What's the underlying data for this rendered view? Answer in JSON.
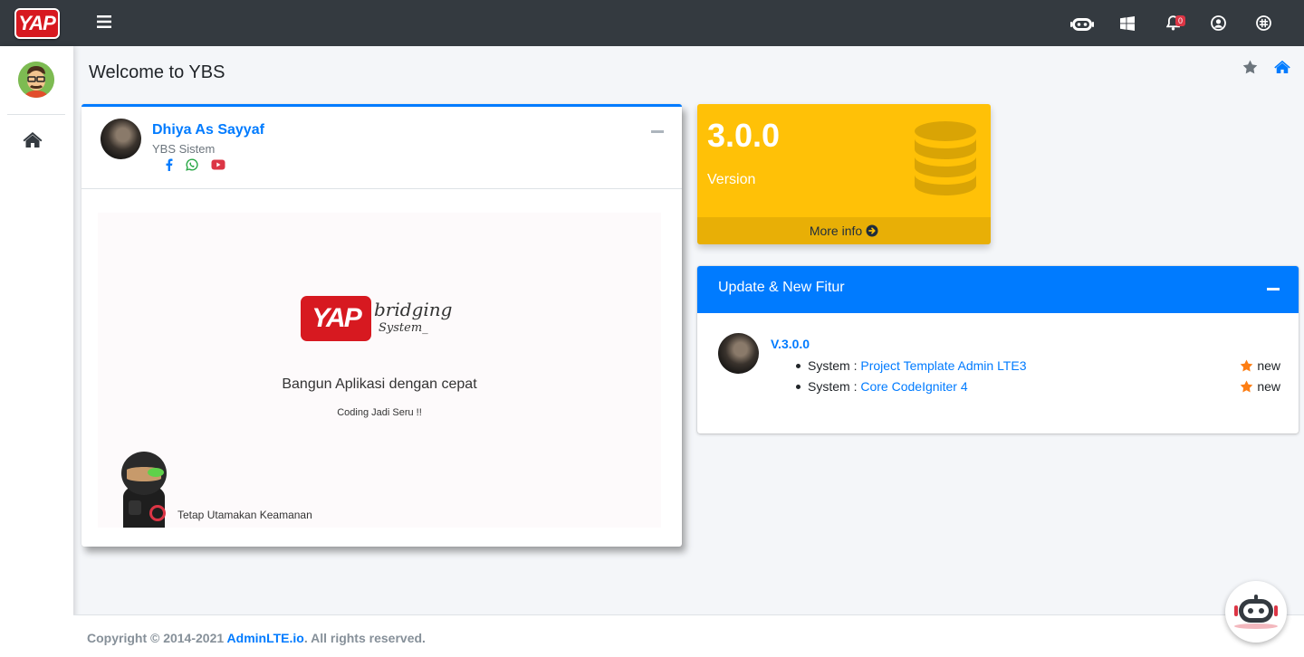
{
  "brand": {
    "logo_text": "YAP"
  },
  "page": {
    "title": "Welcome to YBS"
  },
  "navbar": {
    "notification_count": "0",
    "icons": [
      "robot-icon",
      "windows-icon",
      "bell-icon",
      "user-circle-icon",
      "slack-icon"
    ]
  },
  "profile": {
    "name": "Dhiya As Sayyaf",
    "subtitle": "YBS Sistem"
  },
  "banner": {
    "logo_text": "YAP",
    "bridging": "bridging",
    "system": "System_",
    "tagline": "Bangun Aplikasi dengan cepat",
    "subtagline": "Coding Jadi Seru !!",
    "security_text": "Tetap Utamakan Keamanan"
  },
  "version_box": {
    "number": "3.0.0",
    "label": "Version",
    "more_info": "More info"
  },
  "updates": {
    "title": "Update & New Fitur",
    "version": "V.3.0.0",
    "items": [
      {
        "prefix": "System : ",
        "link": "Project Template Admin LTE3",
        "badge": "new"
      },
      {
        "prefix": "System : ",
        "link": "Core CodeIgniter 4",
        "badge": "new"
      }
    ]
  },
  "footer": {
    "prefix": "Copyright © 2014-2021 ",
    "link": "AdminLTE.io",
    "suffix": ". All rights reserved."
  },
  "colors": {
    "primary": "#007bff",
    "warning": "#ffc107",
    "navbar": "#343a40",
    "brand_red": "#d71920"
  }
}
